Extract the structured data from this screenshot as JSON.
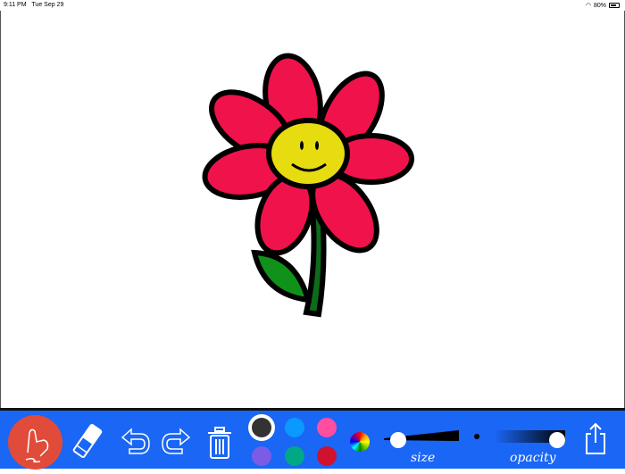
{
  "status": {
    "time": "9:11 PM",
    "date": "Tue Sep 29",
    "battery": "80%",
    "battery_level": 0.8
  },
  "toolbar": {
    "colors": [
      "#333333",
      "#0a99ff",
      "#ff4da0",
      "#7b5ce6",
      "#00a887",
      "#d0122e"
    ],
    "selected_color": "#333333",
    "size_label": "size",
    "opacity_label": "opacity",
    "size_value": 0.1,
    "opacity_value": 1.0,
    "accent": "#1a66f5"
  }
}
